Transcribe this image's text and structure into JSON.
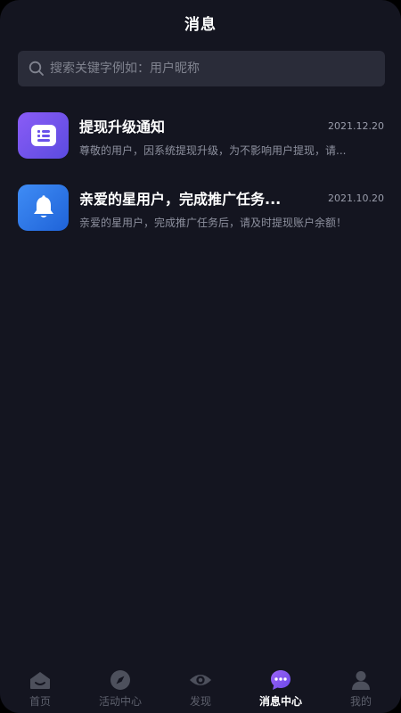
{
  "header": {
    "title": "消息"
  },
  "search": {
    "placeholder": "搜索关键字例如：用户昵称"
  },
  "messages": [
    {
      "icon": "message-list-icon",
      "title": "提现升级通知",
      "date": "2021.12.20",
      "preview": "尊敬的用户，因系统提现升级，为不影响用户提现，请..."
    },
    {
      "icon": "bell-icon",
      "title": "亲爱的星用户，完成推广任务...",
      "date": "2021.10.20",
      "preview": "亲爱的星用户，完成推广任务后，请及时提现账户余额！"
    }
  ],
  "tabbar": {
    "items": [
      {
        "label": "首页",
        "icon": "home-icon"
      },
      {
        "label": "活动中心",
        "icon": "compass-icon"
      },
      {
        "label": "发现",
        "icon": "eye-icon"
      },
      {
        "label": "消息中心",
        "icon": "chat-bubble-icon",
        "active": true
      },
      {
        "label": "我的",
        "icon": "user-icon"
      }
    ]
  },
  "colors": {
    "background": "#141520",
    "search_bg": "#2a2c39",
    "accent_purple": "#7b4ff0",
    "accent_blue": "#2f7bee",
    "inactive_tab": "#5d606c"
  }
}
